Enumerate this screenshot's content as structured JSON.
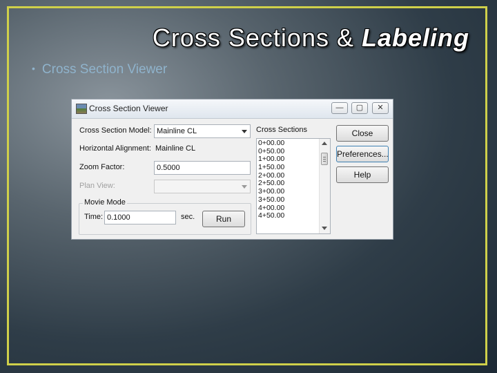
{
  "slide": {
    "title_prefix": "Cross Sections & ",
    "title_emphasis": "Labeling",
    "bullet_marker": "•",
    "bullet": "Cross Section Viewer"
  },
  "window": {
    "title": "Cross Section Viewer",
    "controls": {
      "minimize": "—",
      "maximize": "▢",
      "close": "✕"
    },
    "fields": {
      "model_label": "Cross Section Model:",
      "model_value": "Mainline CL",
      "alignment_label": "Horizontal Alignment:",
      "alignment_value": "Mainline CL",
      "zoom_label": "Zoom Factor:",
      "zoom_value": "0.5000",
      "plan_view_label": "Plan View:",
      "plan_view_value": ""
    },
    "movie_mode": {
      "title": "Movie Mode",
      "time_label": "Time:",
      "time_value": "0.1000",
      "unit": "sec.",
      "run_label": "Run"
    },
    "cross_sections": {
      "label": "Cross Sections",
      "items": [
        "0+00.00",
        "0+50.00",
        "1+00.00",
        "1+50.00",
        "2+00.00",
        "2+50.00",
        "3+00.00",
        "3+50.00",
        "4+00.00",
        "4+50.00"
      ]
    },
    "buttons": {
      "close": "Close",
      "preferences": "Preferences...",
      "help": "Help"
    }
  },
  "colors": {
    "frame": "#cfd04a",
    "bullet_text": "#8fb3cc",
    "title_text": "#ffffff"
  }
}
